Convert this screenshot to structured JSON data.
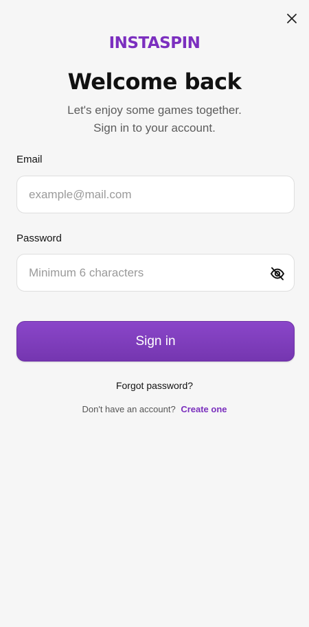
{
  "app": {
    "logo_text": "INSTASPIN",
    "brand_color": "#7b2fbf"
  },
  "header": {
    "close_icon": "close-icon"
  },
  "main": {
    "title": "Welcome back",
    "subtitle_line1": "Let's enjoy some games together.",
    "subtitle_line2": "Sign in to your account."
  },
  "form": {
    "email_label": "Email",
    "email_placeholder": "example@mail.com",
    "email_value": "",
    "password_label": "Password",
    "password_placeholder": "Minimum 6 characters",
    "password_value": "",
    "password_toggle_icon": "eye-off-icon",
    "signin_label": "Sign in"
  },
  "footer": {
    "forgot_label": "Forgot password?",
    "no_account_text": "Don't have an account?",
    "create_label": "Create one",
    "link_color": "#7a2fbd"
  }
}
